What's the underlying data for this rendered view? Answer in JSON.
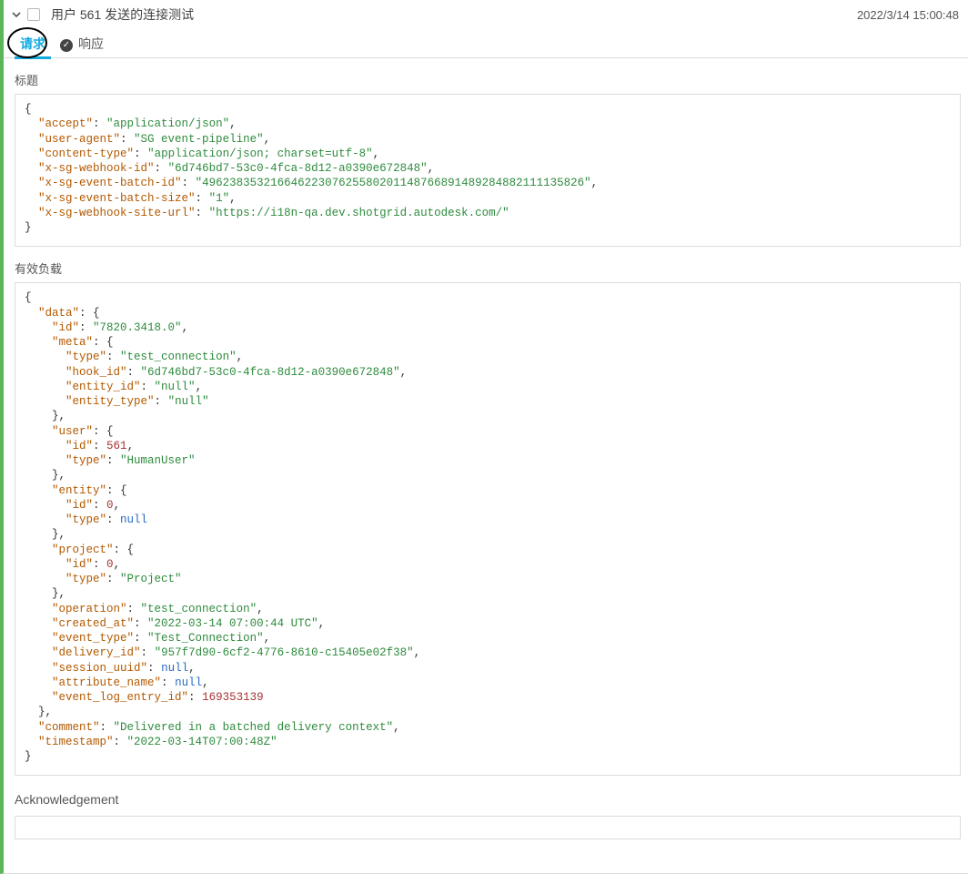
{
  "header": {
    "title": "用户 561 发送的连接测试",
    "timestamp": "2022/3/14 15:00:48"
  },
  "tabs": {
    "request_label": "请求",
    "response_label": "响应"
  },
  "sections": {
    "headers_label": "标题",
    "payload_label": "有效负载",
    "ack_label": "Acknowledgement"
  },
  "request_headers": {
    "accept": "application/json",
    "user-agent": "SG event-pipeline",
    "content-type": "application/json; charset=utf-8",
    "x-sg-webhook-id": "6d746bd7-53c0-4fca-8d12-a0390e672848",
    "x-sg-event-batch-id": "49623835321664622307625580201148766891489284882111135826",
    "x-sg-event-batch-size": "1",
    "x-sg-webhook-site-url": "https://i18n-qa.dev.shotgrid.autodesk.com/"
  },
  "request_payload": {
    "data": {
      "id": "7820.3418.0",
      "meta": {
        "type": "test_connection",
        "hook_id": "6d746bd7-53c0-4fca-8d12-a0390e672848",
        "entity_id": "null",
        "entity_type": "null"
      },
      "user": {
        "id": 561,
        "type": "HumanUser"
      },
      "entity": {
        "id": 0,
        "type": null
      },
      "project": {
        "id": 0,
        "type": "Project"
      },
      "operation": "test_connection",
      "created_at": "2022-03-14 07:00:44 UTC",
      "event_type": "Test_Connection",
      "delivery_id": "957f7d90-6cf2-4776-8610-c15405e02f38",
      "session_uuid": null,
      "attribute_name": null,
      "event_log_entry_id": 169353139
    },
    "comment": "Delivered in a batched delivery context",
    "timestamp": "2022-03-14T07:00:48Z"
  }
}
